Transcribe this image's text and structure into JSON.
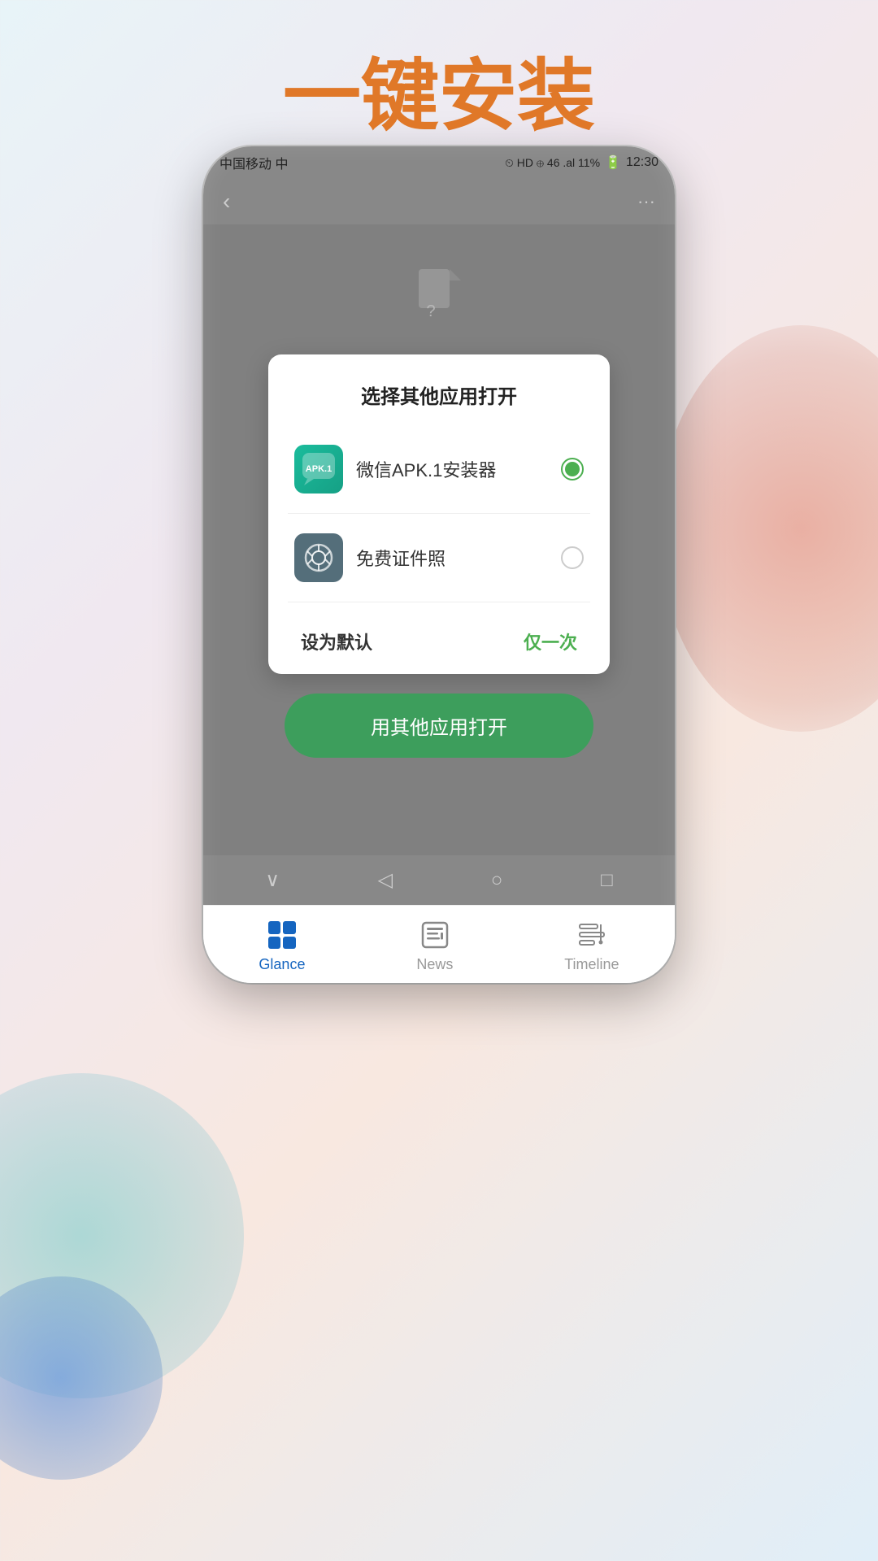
{
  "page": {
    "title": "一键安装",
    "background_colors": {
      "teal": "rgba(100,200,200,0.5)",
      "red": "rgba(220,120,100,0.5)",
      "blue": "rgba(100,150,220,0.7)"
    }
  },
  "status_bar": {
    "carrier": "中国移动 中",
    "icons_right": "⏲ HD ⊕ 46 .al 11% 12:3",
    "time": "12:30",
    "battery_icons": "▼◀ ▐▌"
  },
  "nav_bar": {
    "back_icon": "‹",
    "more_icon": "···"
  },
  "dialog": {
    "title": "选择其他应用打开",
    "option1": {
      "app_name": "微信APK.1安装器",
      "selected": true,
      "icon_text": "APK.1"
    },
    "option2": {
      "app_name": "免费证件照",
      "selected": false
    },
    "btn_default": "设为默认",
    "btn_once": "仅一次"
  },
  "green_button": {
    "label": "用其他应用打开"
  },
  "phone_nav": {
    "icons": [
      "∨",
      "◁",
      "○",
      "□"
    ]
  },
  "tab_bar": {
    "items": [
      {
        "key": "glance",
        "label": "Glance",
        "active": true
      },
      {
        "key": "news",
        "label": "News",
        "active": false
      },
      {
        "key": "timeline",
        "label": "Timeline",
        "active": false
      }
    ]
  }
}
